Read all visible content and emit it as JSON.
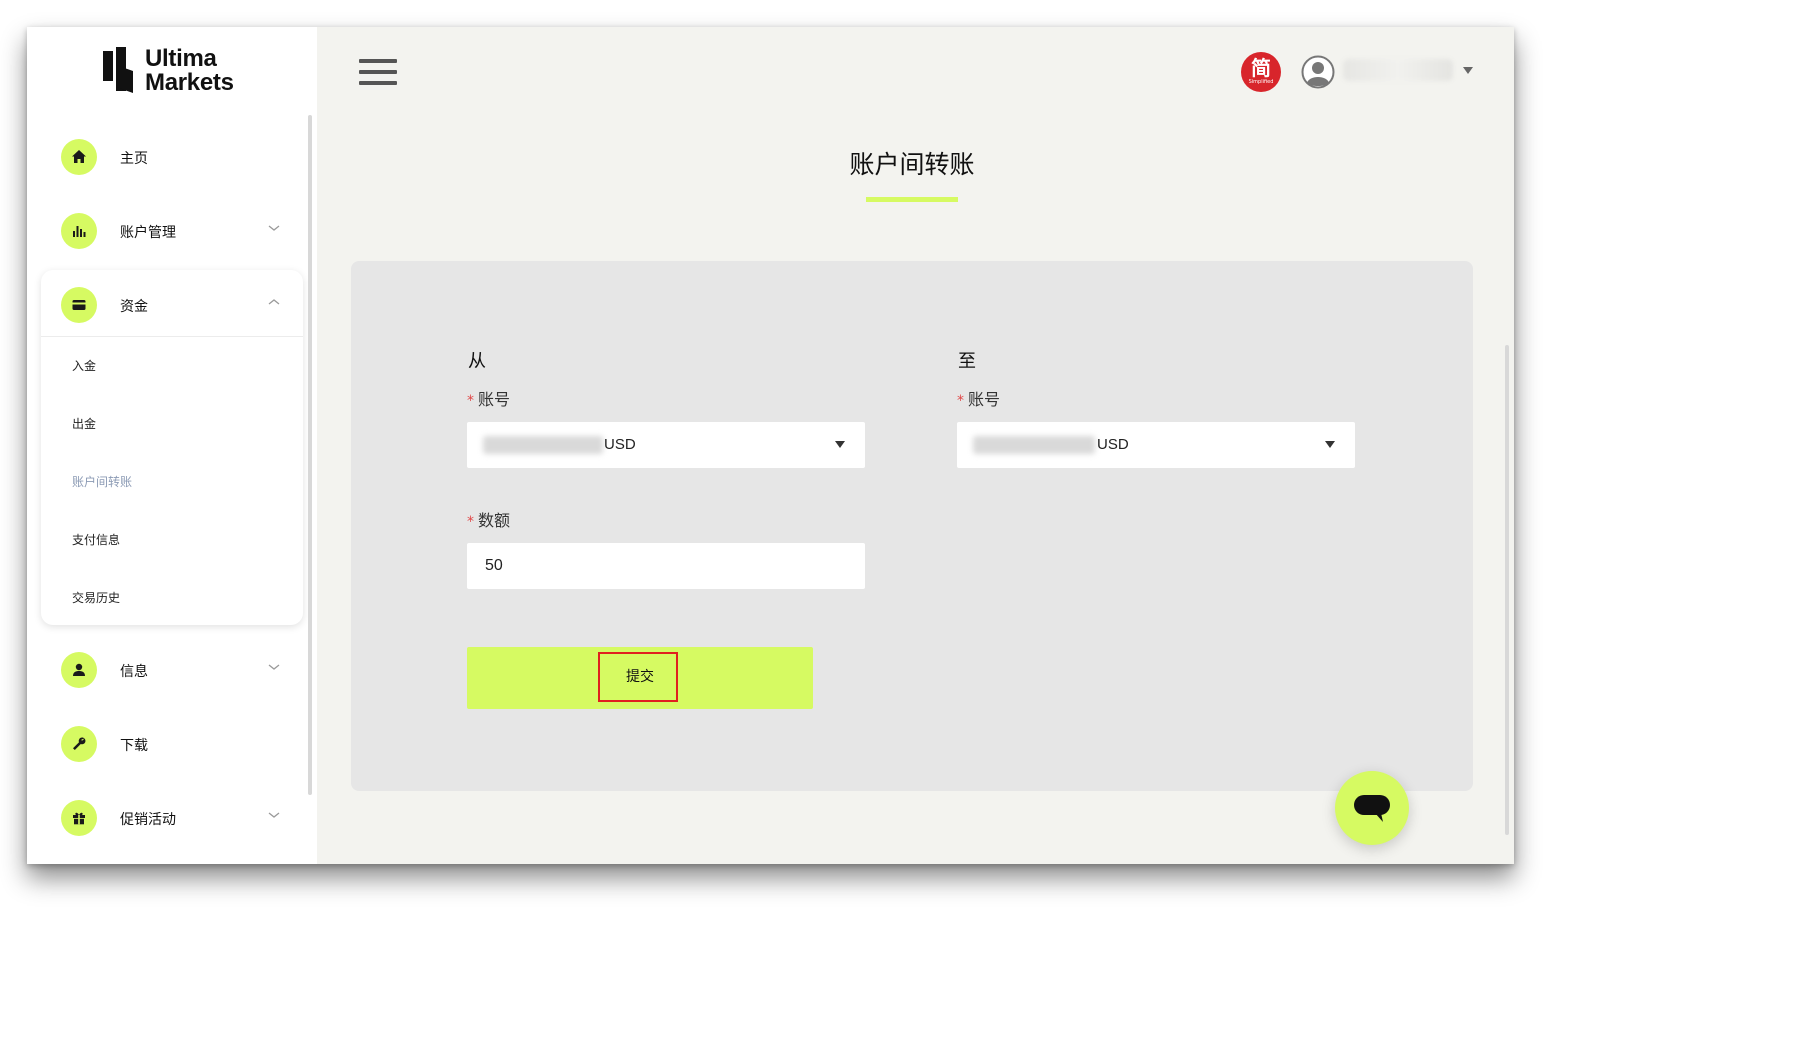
{
  "brand": {
    "line1": "Ultima",
    "line2": "Markets"
  },
  "sidebar": {
    "items": [
      {
        "label": "主页",
        "icon": "home-icon",
        "expandable": false
      },
      {
        "label": "账户管理",
        "icon": "bar-chart-icon",
        "expandable": true
      },
      {
        "label": "资金",
        "icon": "card-icon",
        "expandable": true,
        "expanded": true
      },
      {
        "label": "信息",
        "icon": "user-icon",
        "expandable": true
      },
      {
        "label": "下载",
        "icon": "wrench-icon",
        "expandable": false
      },
      {
        "label": "促销活动",
        "icon": "gift-icon",
        "expandable": true
      }
    ],
    "funds_submenu": [
      {
        "label": "入金",
        "active": false
      },
      {
        "label": "出金",
        "active": false
      },
      {
        "label": "账户间转账",
        "active": true
      },
      {
        "label": "支付信息",
        "active": false
      },
      {
        "label": "交易历史",
        "active": false
      }
    ]
  },
  "header": {
    "language": {
      "char": "简",
      "sub": "Simplified"
    },
    "user_caret": "chevron-down-icon"
  },
  "page": {
    "title": "账户间转账"
  },
  "form": {
    "from": {
      "heading": "从",
      "account_label": "账号",
      "currency": "USD"
    },
    "to": {
      "heading": "至",
      "account_label": "账号",
      "currency": "USD"
    },
    "amount": {
      "label": "数额",
      "value": "50"
    },
    "required_mark": "*",
    "submit_label": "提交"
  },
  "colors": {
    "accent": "#d6fa62",
    "required": "#e04747",
    "highlight": "#e0201f",
    "language_badge": "#d8252b"
  }
}
